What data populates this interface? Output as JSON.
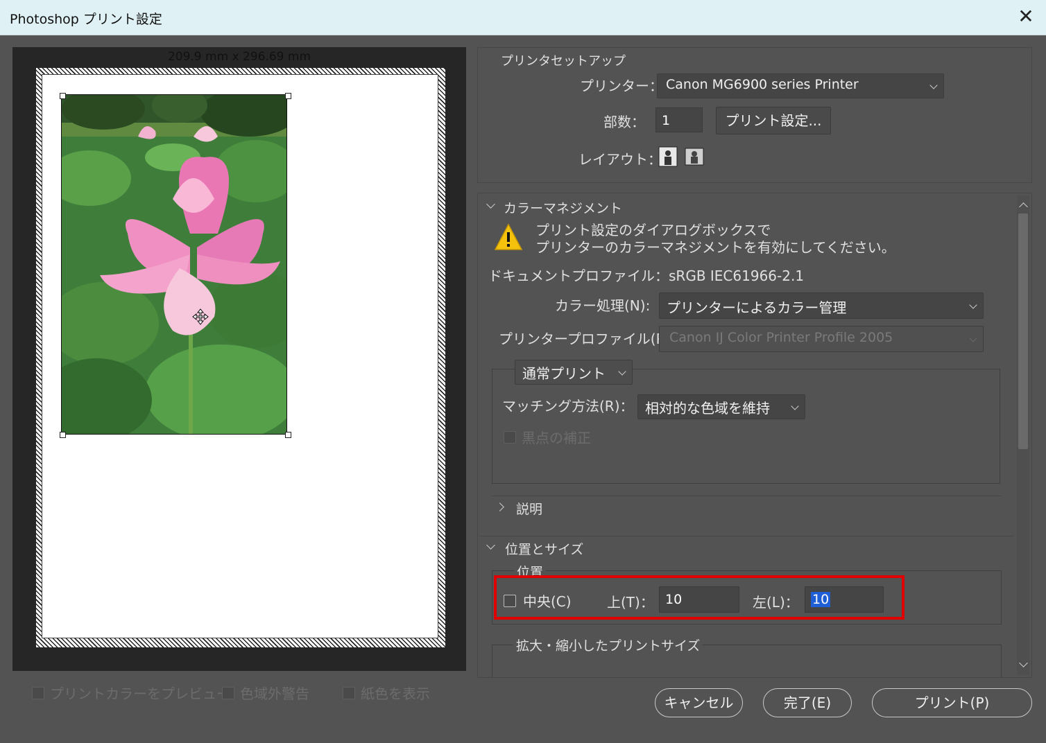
{
  "window": {
    "title": "Photoshop プリント設定",
    "close_glyph": "✕"
  },
  "preview": {
    "paper_size": "209.9 mm x 296.69 mm"
  },
  "bottom_checks": {
    "preview_color": "プリントカラーをプレビュー",
    "gamut_warning": "色域外警告",
    "paper_color": "紙色を表示"
  },
  "printer_setup": {
    "section_title": "プリンタセットアップ",
    "printer_label": "プリンター：",
    "printer_value": "Canon MG6900 series Printer",
    "copies_label": "部数：",
    "copies_value": "1",
    "print_settings_button": "プリント設定...",
    "layout_label": "レイアウト："
  },
  "color_management": {
    "section_title": "カラーマネジメント",
    "warning_line1": "プリント設定のダイアログボックスで",
    "warning_line2": "プリンターのカラーマネジメントを有効にしてください。",
    "document_profile": "ドキュメントプロファイル：sRGB IEC61966-2.1",
    "color_handling_label": "カラー処理(N):",
    "color_handling_value": "プリンターによるカラー管理",
    "printer_profile_label": "プリンタープロファイル(P)：",
    "printer_profile_value": "Canon IJ Color Printer Profile 2005",
    "print_mode_value": "通常プリント",
    "rendering_label": "マッチング方法(R)：",
    "rendering_value": "相対的な色域を維持",
    "black_point_label": "黒点の補正"
  },
  "description": {
    "section_title": "説明"
  },
  "position_size": {
    "section_title": "位置とサイズ",
    "position_group": "位置",
    "center_label": "中央(C)",
    "top_label": "上(T)：",
    "top_value": "10",
    "left_label": "左(L)：",
    "left_value": "10",
    "scaled_group": "拡大・縮小したプリントサイズ"
  },
  "buttons": {
    "cancel": "キャンセル",
    "done": "完了(E)",
    "print": "プリント(P)"
  },
  "colors": {
    "highlight": "#e00000",
    "warning_yellow": "#f4c20d",
    "selection_blue": "#1f5fd6"
  }
}
